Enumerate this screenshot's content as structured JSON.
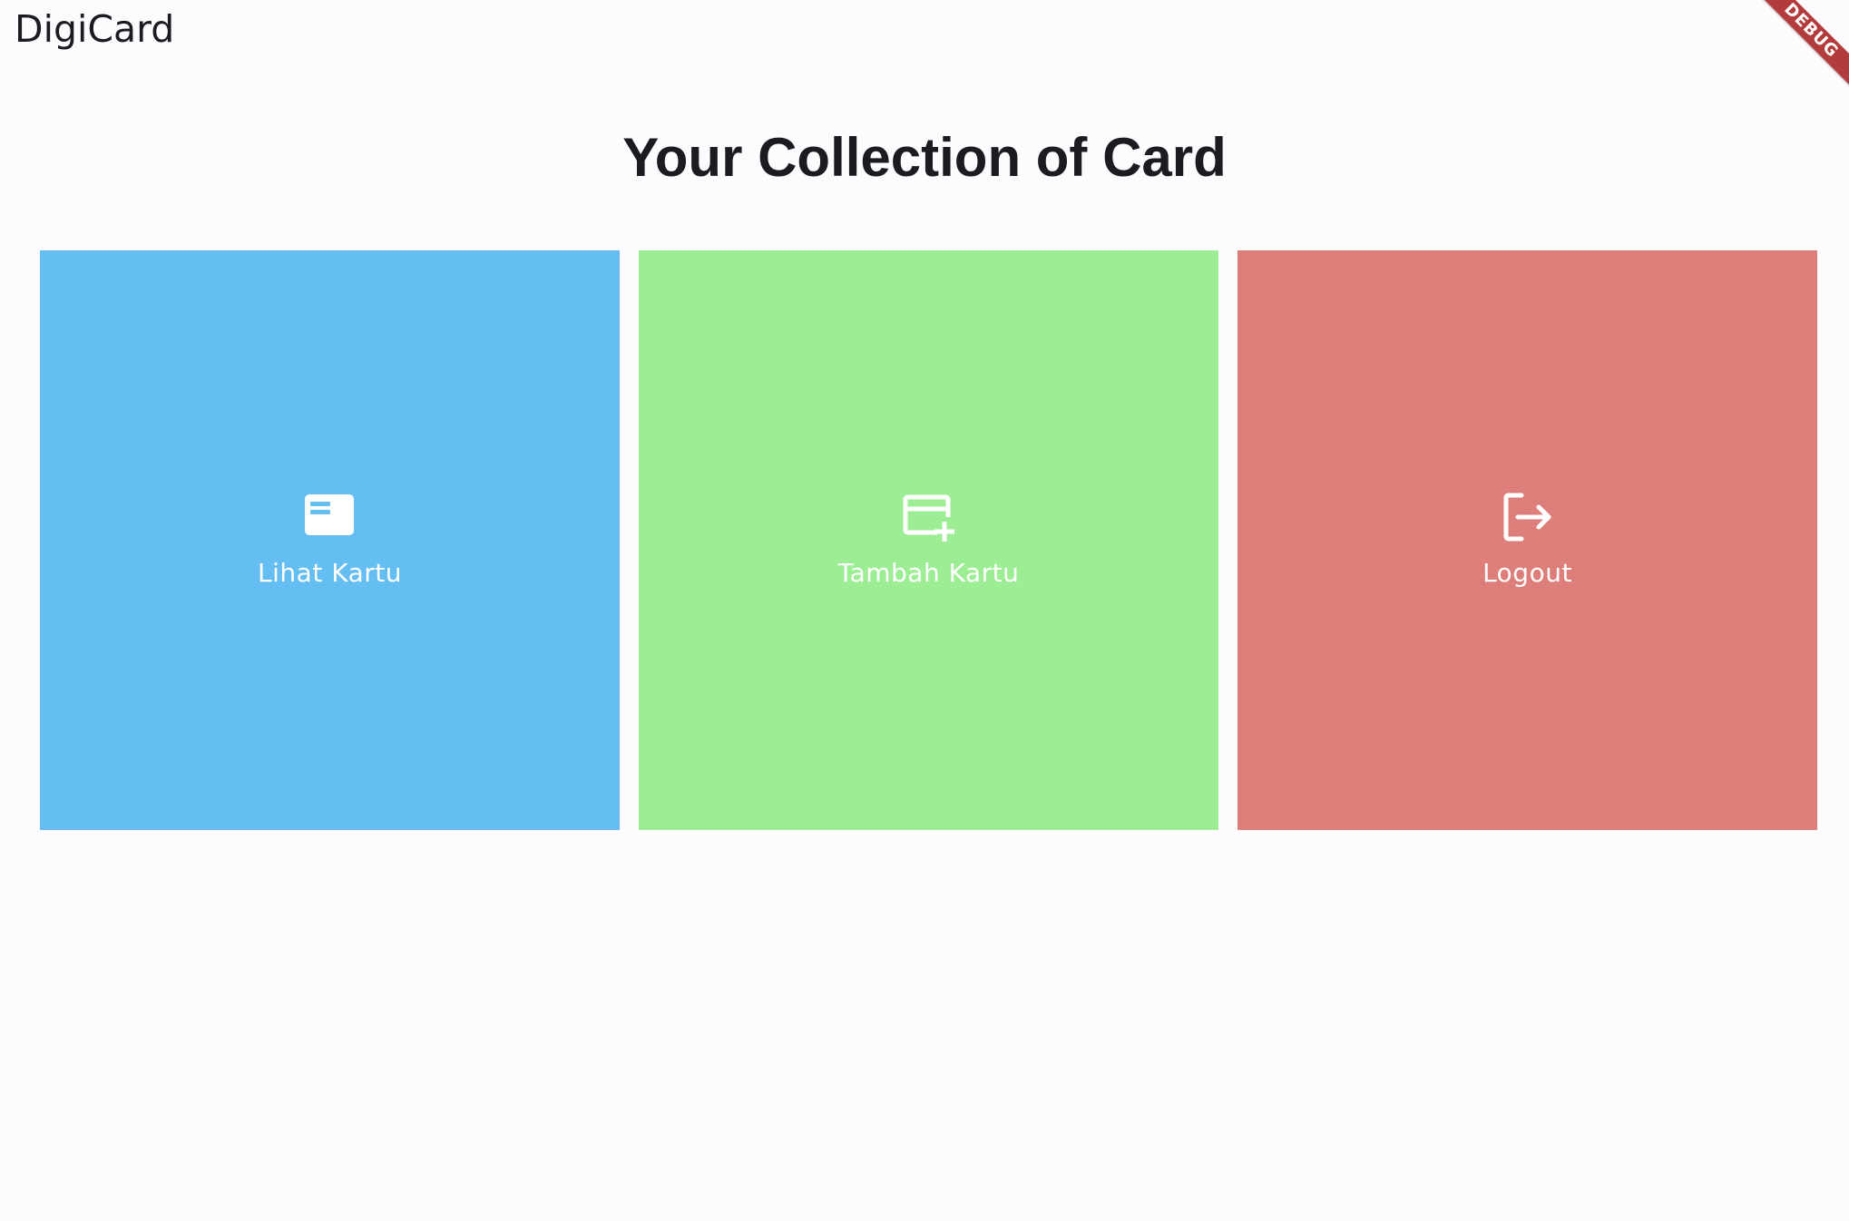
{
  "app": {
    "title": "DigiCard",
    "debug_banner": "DEBUG"
  },
  "main": {
    "heading": "Your Collection of Card",
    "tiles": [
      {
        "label": "Lihat Kartu",
        "icon": "card-icon",
        "color": "#64bef1"
      },
      {
        "label": "Tambah Kartu",
        "icon": "add-card-icon",
        "color": "#9ded95"
      },
      {
        "label": "Logout",
        "icon": "logout-icon",
        "color": "#de7e7a"
      }
    ]
  },
  "colors": {
    "background": "#fdfbfe",
    "text": "#1d1b20",
    "tile_text": "#ffffff",
    "debug_banner": "#b33b3b"
  }
}
